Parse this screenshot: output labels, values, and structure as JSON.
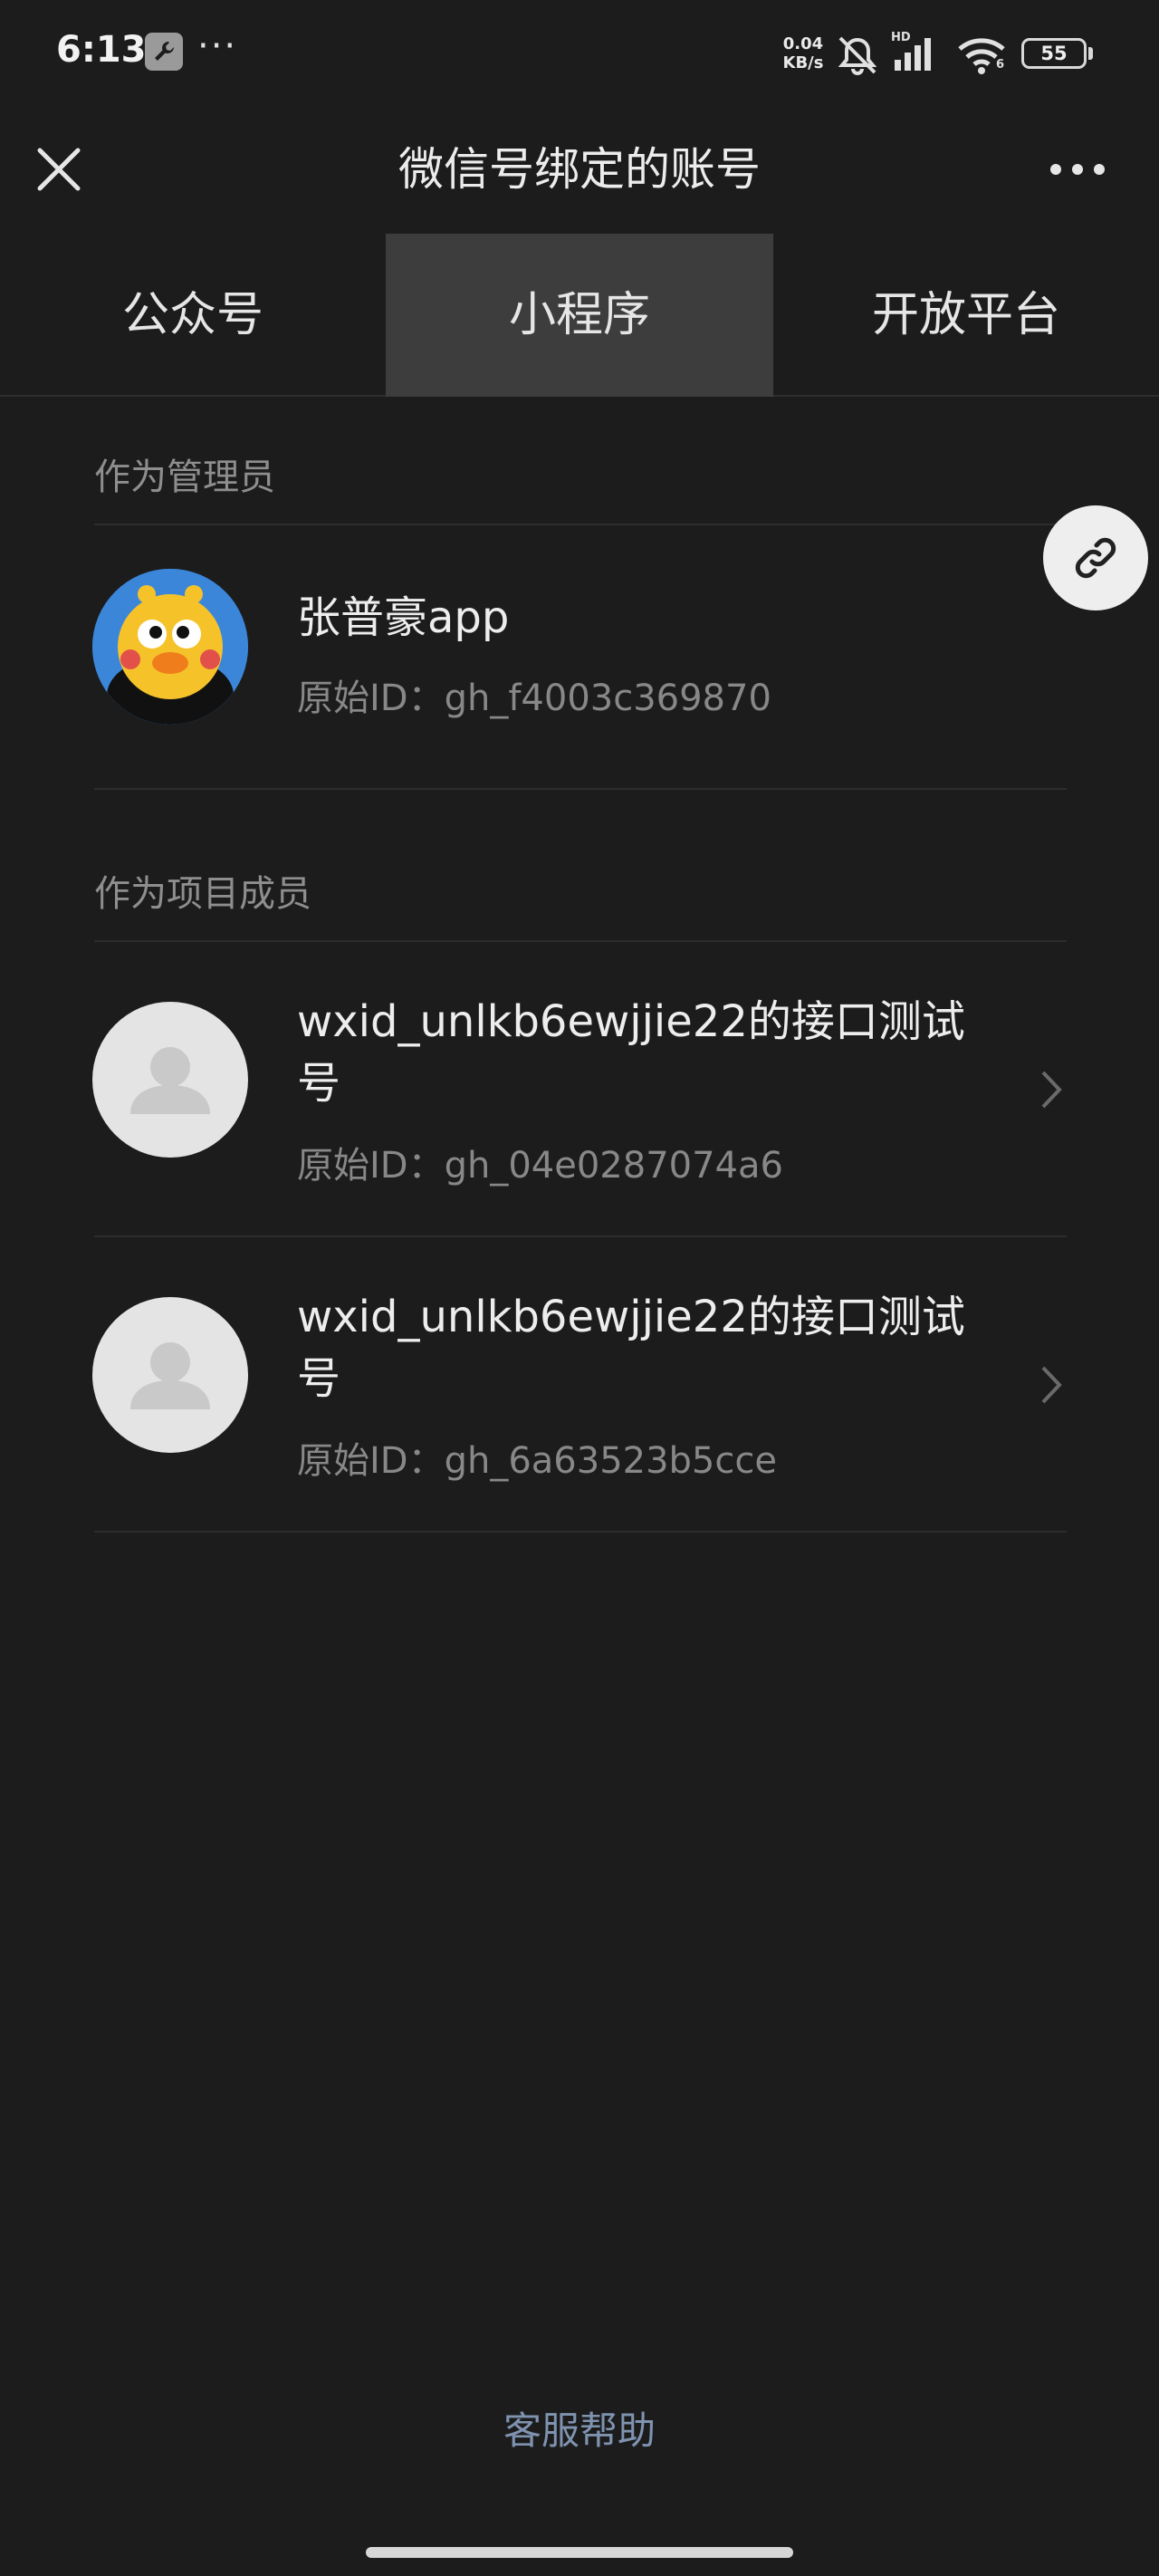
{
  "status_bar": {
    "time": "6:13",
    "more": "···",
    "net_speed_value": "0.04",
    "net_speed_unit": "KB/s",
    "battery": "55",
    "hd_label": "HD",
    "wifi_label": "6",
    "icons": [
      "wrench-icon",
      "mute-bell-icon",
      "signal-icon",
      "wifi-icon",
      "battery-icon"
    ]
  },
  "nav": {
    "title": "微信号绑定的账号",
    "close_icon": "close-icon",
    "more_icon": "more-icon"
  },
  "tabs": [
    {
      "label": "公众号",
      "active": false
    },
    {
      "label": "小程序",
      "active": true
    },
    {
      "label": "开放平台",
      "active": false
    }
  ],
  "sections": {
    "admin": {
      "title": "作为管理员",
      "items": [
        {
          "name": "张普豪app",
          "id": "原始ID：gh_f4003c369870",
          "avatar": "cartoon-duck-avatar"
        }
      ]
    },
    "member": {
      "title": "作为项目成员",
      "items": [
        {
          "name": "wxid_unlkb6ewjjie22的接口测试号",
          "id": "原始ID：gh_04e0287074a6",
          "avatar": "default-user-avatar"
        },
        {
          "name": "wxid_unlkb6ewjjie22的接口测试号",
          "id": "原始ID：gh_6a63523b5cce",
          "avatar": "default-user-avatar"
        }
      ]
    }
  },
  "link_button_icon": "link-icon",
  "footer": {
    "help": "客服帮助"
  },
  "colors": {
    "background": "#1c1c1c",
    "active_tab": "#3d3d3d",
    "help_link": "#7f93b0",
    "secondary_text": "#888888"
  }
}
